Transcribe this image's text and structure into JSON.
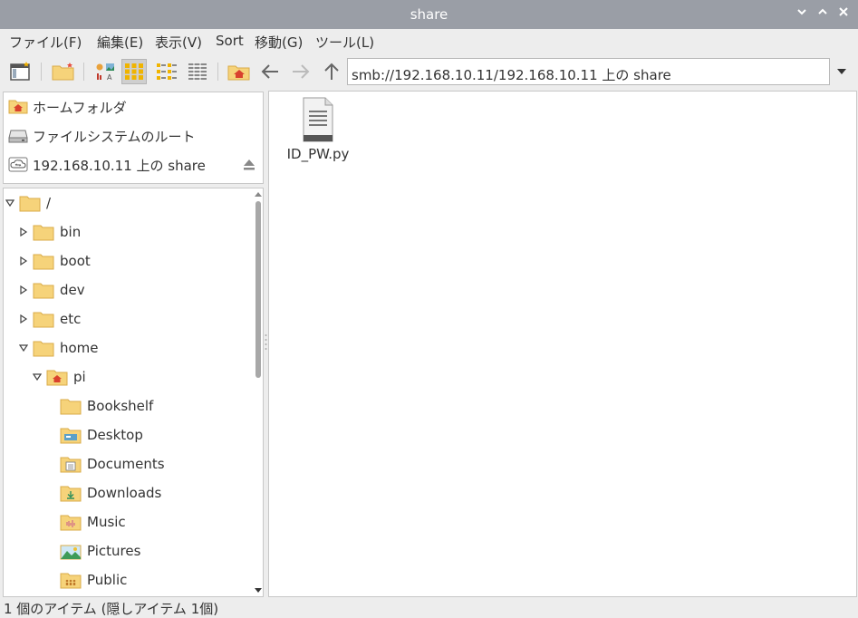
{
  "window": {
    "title": "share"
  },
  "menu": [
    "ファイル(F)",
    "編集(E)",
    "表示(V)",
    "Sort",
    "移動(G)",
    "ツール(L)"
  ],
  "toolbar": {
    "address": "smb://192.168.10.11/192.168.10.11 上の share"
  },
  "places": [
    {
      "label": "ホームフォルダ",
      "icon": "home-folder-icon"
    },
    {
      "label": "ファイルシステムのルート",
      "icon": "drive-icon"
    },
    {
      "label": "192.168.10.11 上の share",
      "icon": "network-share-icon"
    }
  ],
  "tree": [
    {
      "label": "/",
      "depth": 0,
      "expander": "expanded",
      "icon": "folder-icon"
    },
    {
      "label": "bin",
      "depth": 1,
      "expander": "collapsed",
      "icon": "folder-icon"
    },
    {
      "label": "boot",
      "depth": 1,
      "expander": "collapsed",
      "icon": "folder-icon"
    },
    {
      "label": "dev",
      "depth": 1,
      "expander": "collapsed",
      "icon": "folder-icon"
    },
    {
      "label": "etc",
      "depth": 1,
      "expander": "collapsed",
      "icon": "folder-icon"
    },
    {
      "label": "home",
      "depth": 1,
      "expander": "expanded",
      "icon": "folder-icon"
    },
    {
      "label": "pi",
      "depth": 2,
      "expander": "expanded",
      "icon": "home-folder-icon"
    },
    {
      "label": "Bookshelf",
      "depth": 3,
      "expander": "none",
      "icon": "folder-icon"
    },
    {
      "label": "Desktop",
      "depth": 3,
      "expander": "none",
      "icon": "desktop-folder-icon"
    },
    {
      "label": "Documents",
      "depth": 3,
      "expander": "none",
      "icon": "documents-folder-icon"
    },
    {
      "label": "Downloads",
      "depth": 3,
      "expander": "none",
      "icon": "downloads-folder-icon"
    },
    {
      "label": "Music",
      "depth": 3,
      "expander": "none",
      "icon": "music-folder-icon"
    },
    {
      "label": "Pictures",
      "depth": 3,
      "expander": "none",
      "icon": "pictures-folder-icon"
    },
    {
      "label": "Public",
      "depth": 3,
      "expander": "none",
      "icon": "public-folder-icon"
    }
  ],
  "files": [
    {
      "name": "ID_PW.py",
      "icon": "text-file-icon"
    }
  ],
  "status": "1 個のアイテム (隠しアイテム 1個)",
  "colors": {
    "folder": "#f6d37a",
    "folder_edge": "#d9ab48",
    "home_red": "#d9412e",
    "titlebar": "#9a9ea6"
  }
}
